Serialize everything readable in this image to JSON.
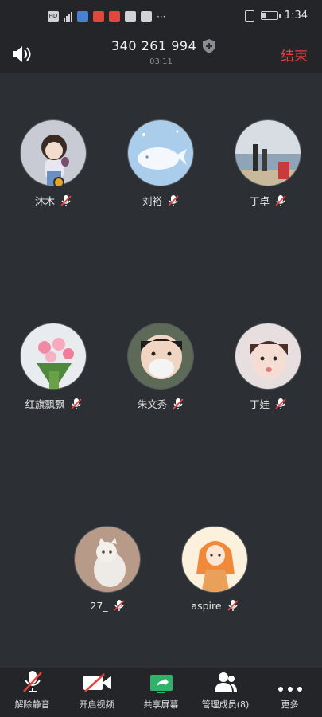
{
  "status_bar": {
    "time": "1:34",
    "left_icons": [
      "hd-icon",
      "signal-icon",
      "signal-icon",
      "app-icon",
      "mic-red-icon",
      "message-icon",
      "app-icon",
      "more-dots-icon"
    ],
    "right_icons": [
      "vibrate-icon",
      "battery-icon"
    ],
    "battery_level": 0.25
  },
  "header": {
    "meeting_id": "340 261 994",
    "timer": "03:11",
    "end_label": "结束"
  },
  "participants": [
    {
      "name": "沐木",
      "host": true,
      "muted": true
    },
    {
      "name": "刘裕",
      "host": false,
      "muted": true
    },
    {
      "name": "丁卓",
      "host": false,
      "muted": true
    },
    {
      "name": "红旗飘飘",
      "host": false,
      "muted": true
    },
    {
      "name": "朱文秀",
      "host": false,
      "muted": true
    },
    {
      "name": "丁娃",
      "host": false,
      "muted": true
    },
    {
      "name": "27_",
      "host": false,
      "muted": true
    },
    {
      "name": "aspire",
      "host": false,
      "muted": true
    }
  ],
  "toolbar": {
    "unmute_label": "解除静音",
    "video_label": "开启视频",
    "share_label": "共享屏幕",
    "members_label": "管理成员(8)",
    "more_label": "更多"
  },
  "colors": {
    "background": "#2c2f33",
    "bar": "#232528",
    "accent_red": "#e8413c",
    "share_green": "#2fb36b"
  }
}
